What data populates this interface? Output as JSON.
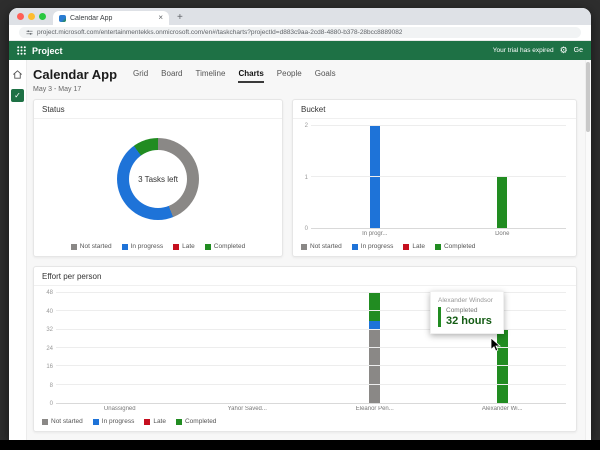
{
  "browser": {
    "tab_title": "Calendar App",
    "url": "project.microsoft.com/entertainmentekks.onmicrosoft.com/en#/taskcharts?projectId=d883c9aa-2cd8-4880-b378-28bcc8889082",
    "new_tab_label": "+",
    "close_tab_label": "×"
  },
  "app_header": {
    "app_name": "Project",
    "trial_message": "Your trial has expired",
    "get_label": "Ge"
  },
  "page": {
    "title": "Calendar App",
    "date_range": "May 3 - May 17",
    "tabs": [
      {
        "label": "Grid"
      },
      {
        "label": "Board"
      },
      {
        "label": "Timeline"
      },
      {
        "label": "Charts"
      },
      {
        "label": "People"
      },
      {
        "label": "Goals"
      }
    ]
  },
  "legend": {
    "items": [
      {
        "label": "Not started",
        "color": "#8a8886"
      },
      {
        "label": "In progress",
        "color": "#1e73d8"
      },
      {
        "label": "Late",
        "color": "#c50f1f"
      },
      {
        "label": "Completed",
        "color": "#218c21"
      }
    ]
  },
  "tooltip": {
    "name": "Alexander Windsor",
    "status": "Completed",
    "value": "32 hours"
  },
  "colors": {
    "header_green": "#1e7145",
    "completed_green": "#218c21",
    "in_progress_blue": "#1e73d8",
    "not_started_gray": "#8a8886",
    "late_red": "#c50f1f"
  },
  "chart_data": [
    {
      "type": "donut",
      "title": "Status",
      "center_label": "3 Tasks left",
      "segments": [
        {
          "label": "Not started",
          "color": "#8a8886",
          "value": 44
        },
        {
          "label": "In progress",
          "color": "#1e73d8",
          "value": 46
        },
        {
          "label": "Late",
          "color": "#c50f1f",
          "value": 0
        },
        {
          "label": "Completed",
          "color": "#218c21",
          "value": 10
        }
      ],
      "legend_position": "bottom"
    },
    {
      "type": "bar",
      "title": "Bucket",
      "categories": [
        "In progr...",
        "Done"
      ],
      "values": [
        2,
        1
      ],
      "bar_colors": [
        "#1e73d8",
        "#218c21"
      ],
      "ylim": [
        0,
        2
      ],
      "yticks": [
        0,
        1,
        2
      ],
      "legend_position": "bottom"
    },
    {
      "type": "stacked-bar",
      "title": "Effort per person",
      "categories": [
        "Unassigned",
        "Yahor Saved...",
        "Eleanor Pen...",
        "Alexander Wi..."
      ],
      "series": [
        {
          "name": "Not started",
          "color": "#8a8886",
          "values": [
            0,
            0,
            32,
            0
          ]
        },
        {
          "name": "In progress",
          "color": "#1e73d8",
          "values": [
            0,
            0,
            4,
            0
          ]
        },
        {
          "name": "Late",
          "color": "#c50f1f",
          "values": [
            0,
            0,
            0,
            0
          ]
        },
        {
          "name": "Completed",
          "color": "#218c21",
          "values": [
            0,
            0,
            12,
            32
          ]
        }
      ],
      "ylim": [
        0,
        48
      ],
      "yticks": [
        0,
        8,
        16,
        24,
        32,
        40,
        48
      ],
      "ylabel_unit": "hours",
      "legend_position": "bottom"
    }
  ]
}
